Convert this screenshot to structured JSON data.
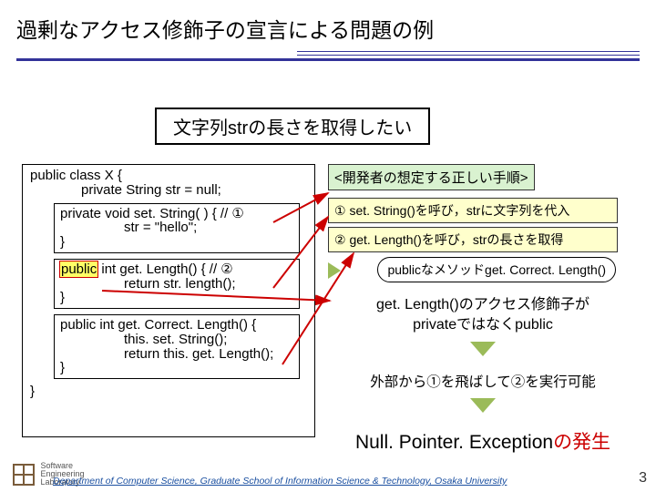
{
  "title": "過剰なアクセス修飾子の宣言による問題の例",
  "goal": "文字列strの長さを取得したい",
  "code": {
    "class_open": "public class X {",
    "field": "private String str = null;",
    "m1_open": "private void set. String( ) { // ①",
    "m1_body": "str = \"hello\";",
    "m1_close": "}",
    "m2_mod": "public",
    "m2_rest": " int get. Length() { // ②",
    "m2_body": "return str. length();",
    "m2_close": "}",
    "m3_open": "public int get. Correct. Length() {",
    "m3_b1": "this. set. String();",
    "m3_b2": "return this. get. Length();",
    "m3_close": "}",
    "class_close": "}"
  },
  "procedure": {
    "heading": "<開発者の想定する正しい手順>",
    "step1": "① set. String()を呼び，strに文字列を代入",
    "step2": "② get. Length()を呼び，strの長さを取得",
    "bubble": "publicなメソッドget. Correct. Length()"
  },
  "note_lines": {
    "l1": "get. Length()のアクセス修飾子が",
    "l2": "privateではなくpublic"
  },
  "note2": "外部から①を飛ばして②を実行可能",
  "npe_black": "Null. Pointer. Exception",
  "npe_red": "の発生",
  "footer": "Department of Computer Science, Graduate School of Information Science & Technology, Osaka University",
  "logo_top": "Software",
  "logo_mid": "Engineering",
  "logo_bot": "Laboratory",
  "page_number": "3"
}
